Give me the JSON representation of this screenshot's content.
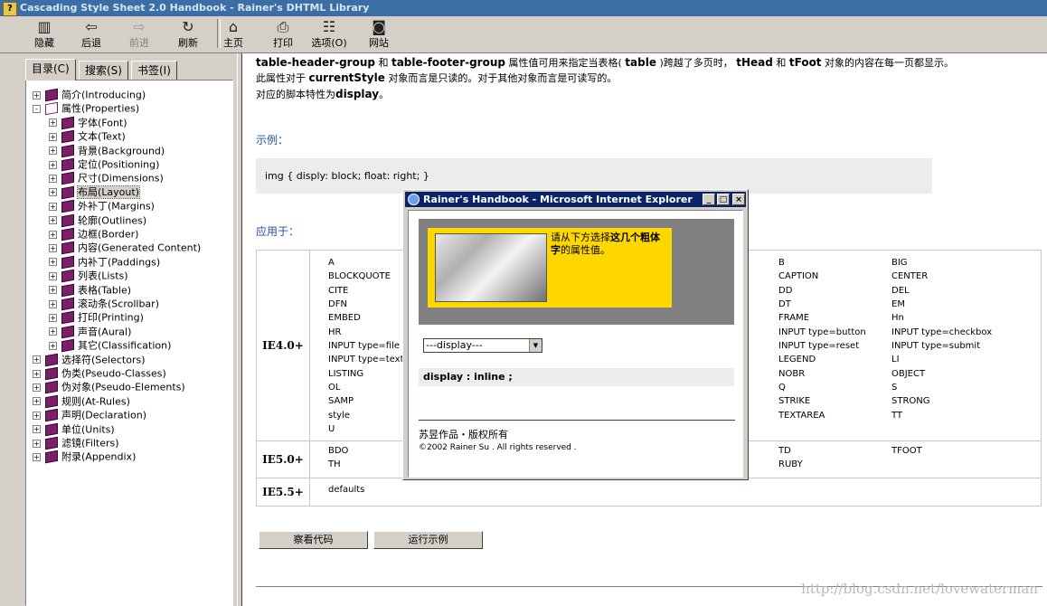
{
  "window": {
    "title": "Cascading Style Sheet 2.0 Handbook - Rainer's DHTML Library"
  },
  "toolbar": [
    {
      "label": "隐藏",
      "icon": "hide-icon",
      "disabled": false
    },
    {
      "label": "后退",
      "icon": "back-icon",
      "disabled": false
    },
    {
      "label": "前进",
      "icon": "forward-icon",
      "disabled": true
    },
    {
      "label": "刷新",
      "icon": "refresh-icon",
      "disabled": false
    },
    {
      "label": "主页",
      "icon": "home-icon",
      "disabled": false
    },
    {
      "label": "打印",
      "icon": "print-icon",
      "disabled": false
    },
    {
      "label": "选项(O)",
      "icon": "options-icon",
      "disabled": false
    },
    {
      "label": "网站",
      "icon": "website-icon",
      "disabled": false
    }
  ],
  "nav_tabs": [
    "目录(C)",
    "搜索(S)",
    "书签(I)"
  ],
  "tree": [
    {
      "label": "简介(Introducing)",
      "level": 0,
      "sign": "+"
    },
    {
      "label": "属性(Properties)",
      "level": 0,
      "sign": "-",
      "open": true
    },
    {
      "label": "字体(Font)",
      "level": 1,
      "sign": "+"
    },
    {
      "label": "文本(Text)",
      "level": 1,
      "sign": "+"
    },
    {
      "label": "背景(Background)",
      "level": 1,
      "sign": "+"
    },
    {
      "label": "定位(Positioning)",
      "level": 1,
      "sign": "+"
    },
    {
      "label": "尺寸(Dimensions)",
      "level": 1,
      "sign": "+"
    },
    {
      "label": "布局(Layout)",
      "level": 1,
      "sign": "+",
      "selected": true
    },
    {
      "label": "外补丁(Margins)",
      "level": 1,
      "sign": "+"
    },
    {
      "label": "轮廓(Outlines)",
      "level": 1,
      "sign": "+"
    },
    {
      "label": "边框(Border)",
      "level": 1,
      "sign": "+"
    },
    {
      "label": "内容(Generated Content)",
      "level": 1,
      "sign": "+"
    },
    {
      "label": "内补丁(Paddings)",
      "level": 1,
      "sign": "+"
    },
    {
      "label": "列表(Lists)",
      "level": 1,
      "sign": "+"
    },
    {
      "label": "表格(Table)",
      "level": 1,
      "sign": "+"
    },
    {
      "label": "滚动条(Scrollbar)",
      "level": 1,
      "sign": "+"
    },
    {
      "label": "打印(Printing)",
      "level": 1,
      "sign": "+"
    },
    {
      "label": "声音(Aural)",
      "level": 1,
      "sign": "+"
    },
    {
      "label": "其它(Classification)",
      "level": 1,
      "sign": "+"
    },
    {
      "label": "选择符(Selectors)",
      "level": 0,
      "sign": "+"
    },
    {
      "label": "伪类(Pseudo-Classes)",
      "level": 0,
      "sign": "+"
    },
    {
      "label": "伪对象(Pseudo-Elements)",
      "level": 0,
      "sign": "+"
    },
    {
      "label": "规则(At-Rules)",
      "level": 0,
      "sign": "+"
    },
    {
      "label": "声明(Declaration)",
      "level": 0,
      "sign": "+"
    },
    {
      "label": "单位(Units)",
      "level": 0,
      "sign": "+"
    },
    {
      "label": "滤镜(Filters)",
      "level": 0,
      "sign": "+"
    },
    {
      "label": "附录(Appendix)",
      "level": 0,
      "sign": "+"
    }
  ],
  "content": {
    "line1": {
      "k1": "table-header-group",
      "t1": " 和 ",
      "k2": "table-footer-group",
      "t2": " 属性值可用来指定当表格( ",
      "k3": "table",
      "t3": " )跨越了多页时， ",
      "k4": "tHead",
      "t4": " 和 ",
      "k5": "tFoot",
      "t5": " 对象的内容在每一页都显示。"
    },
    "line2": {
      "a": "此属性对于 ",
      "k": "currentStyle",
      "b": " 对象而言是只读的。对于其他对象而言是可读写的。"
    },
    "line3": {
      "a": "对应的脚本特性为",
      "k": "display",
      "b": "。"
    },
    "example_heading": "示例：",
    "example_code": "img { disply: block; float: right; }",
    "applies_heading": "应用于：",
    "table": [
      {
        "version": "IE4.0+",
        "col1": [
          "A",
          "BLOCKQUOTE",
          "CITE",
          "DFN",
          "EMBED",
          "HR",
          "INPUT type=file",
          "INPUT type=text",
          "LISTING",
          "OL",
          "SAMP",
          "style",
          "U"
        ],
        "col2": [
          "B",
          "CAPTION",
          "DD",
          "DT",
          "FRAME",
          "INPUT type=button",
          "INPUT type=reset",
          "LEGEND",
          "NOBR",
          "Q",
          "STRIKE",
          "TEXTAREA"
        ],
        "col3": [
          "BIG",
          "CENTER",
          "DEL",
          "EM",
          "Hn",
          "INPUT type=checkbox",
          "INPUT type=submit",
          "LI",
          "OBJECT",
          "S",
          "STRONG",
          "TT"
        ]
      },
      {
        "version": "IE5.0+",
        "col1": [
          "BDO",
          "TH"
        ],
        "col2": [
          "TD",
          "RUBY"
        ],
        "col3": [
          "TFOOT"
        ]
      },
      {
        "version": "IE5.5+",
        "col1": [
          "defaults"
        ],
        "col2": [],
        "col3": []
      }
    ],
    "buttons": [
      "察看代码",
      "运行示例"
    ],
    "watermark": "http://blog.csdn.net/lovewaterman"
  },
  "popup": {
    "title": "Rainer's Handbook - Microsoft Internet Explorer",
    "controls": [
      "_",
      "□",
      "×"
    ],
    "prompt_a": "请从下方选择",
    "prompt_b": "这几个粗体字",
    "prompt_c": "的属性值。",
    "select_value": "---display---",
    "display_text": "display : inline ;",
    "footer1": "苏昱作品・版权所有",
    "footer2": "©2002 Rainer Su . All rights reserved ."
  }
}
